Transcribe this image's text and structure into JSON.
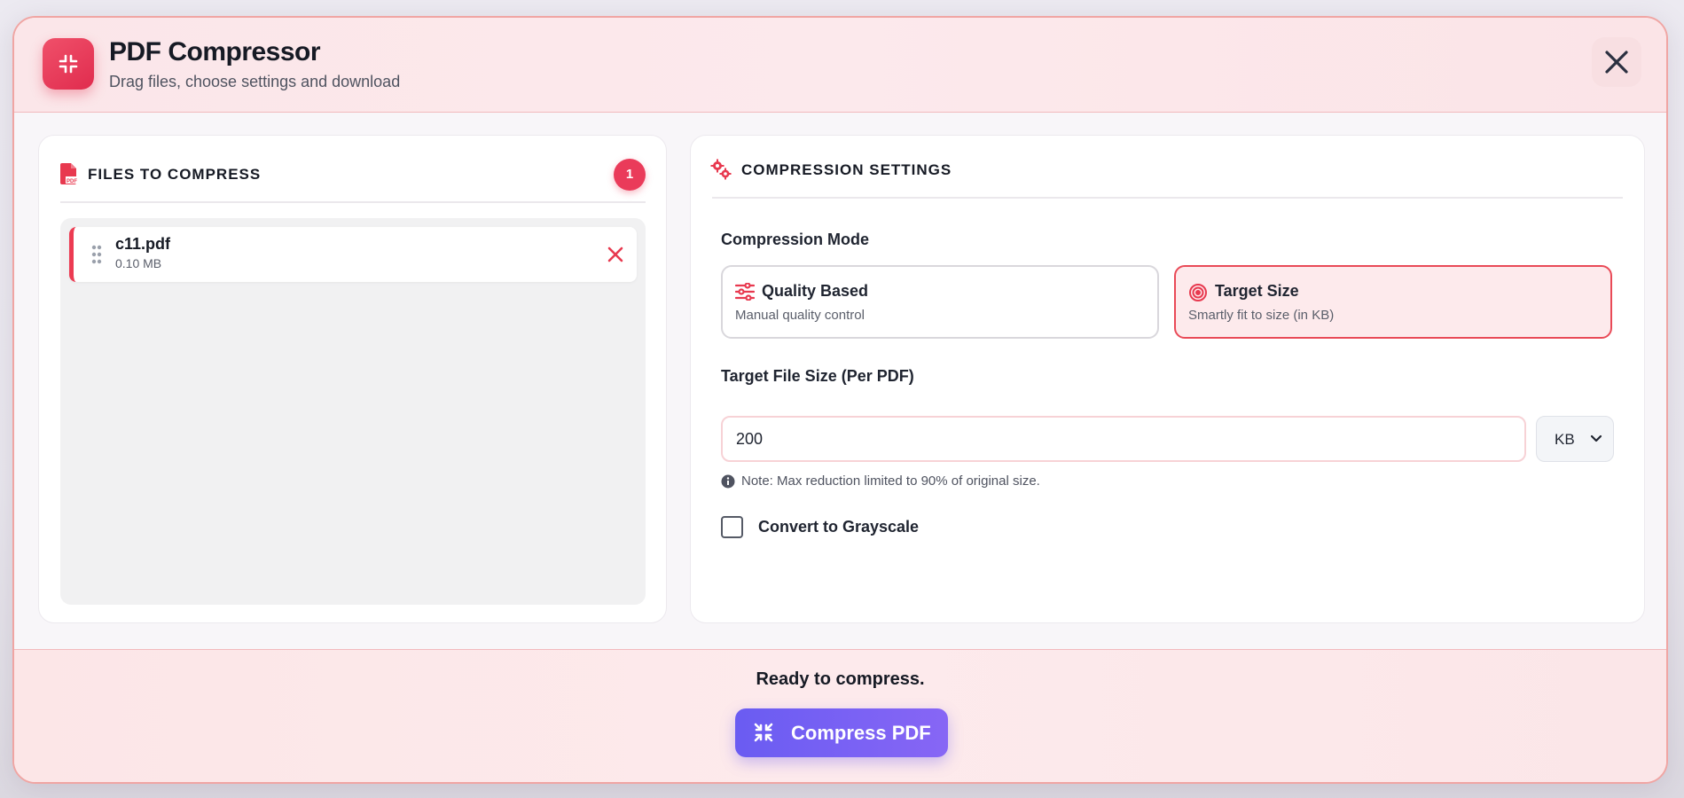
{
  "header": {
    "title": "PDF Compressor",
    "subtitle": "Drag files, choose settings and download",
    "logo_icon": "compress-icon",
    "close_icon": "close-icon"
  },
  "files_panel": {
    "title": "FILES TO COMPRESS",
    "icon": "pdf-file-icon",
    "count": "1",
    "files": [
      {
        "name": "c11.pdf",
        "size": "0.10 MB"
      }
    ]
  },
  "settings_panel": {
    "title": "COMPRESSION SETTINGS",
    "icon": "gears-icon",
    "mode_label": "Compression Mode",
    "modes": [
      {
        "title": "Quality Based",
        "description": "Manual quality control",
        "icon": "sliders-icon",
        "selected": false
      },
      {
        "title": "Target Size",
        "description": "Smartly fit to size (in KB)",
        "icon": "target-icon",
        "selected": true
      }
    ],
    "target_size_label": "Target File Size (Per PDF)",
    "target_size_value": "200",
    "unit": "KB",
    "note": "Note: Max reduction limited to 90% of original size.",
    "grayscale_label": "Convert to Grayscale",
    "grayscale_checked": false
  },
  "footer": {
    "status": "Ready to compress.",
    "compress_button": "Compress PDF"
  },
  "colors": {
    "accent_red": "#ea3b5a",
    "button_purple": "#7a62f4",
    "selected_card_bg": "#fdeaec"
  }
}
